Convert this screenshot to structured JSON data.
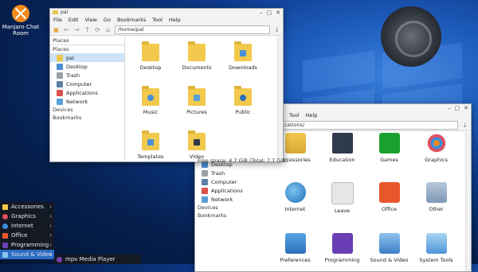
{
  "desktop": {
    "icon_label": "Manjaro Chat\nRoom"
  },
  "window1": {
    "title": "pal",
    "menu": [
      "File",
      "Edit",
      "View",
      "Go",
      "Bookmarks",
      "Tool",
      "Help"
    ],
    "path": "/home/pal",
    "places_header_top": "Places",
    "places_header": "Places",
    "places": [
      "pal",
      "Desktop",
      "Trash",
      "Computer",
      "Applications",
      "Network"
    ],
    "devices": "Devices",
    "bookmarks": "Bookmarks",
    "files": [
      "Desktop",
      "Documents",
      "Downloads",
      "Music",
      "Pictures",
      "Public",
      "Templates",
      "Video"
    ]
  },
  "window2": {
    "menu": [
      "Tool",
      "Help"
    ],
    "path": "lications/",
    "places": [
      "Desktop",
      "Trash",
      "Computer",
      "Applications",
      "Network"
    ],
    "devices": "Devices",
    "bookmarks": "Bookmarks",
    "status": "Free space: 4.7 GiB (Total: 7.7 GiB)",
    "apps": [
      "Accessories",
      "Education",
      "Games",
      "Graphics",
      "Internet",
      "Leave",
      "Office",
      "Other",
      "Preferences",
      "Programming",
      "Sound & Video",
      "System Tools"
    ]
  },
  "startmenu": {
    "items": [
      "Accessories",
      "Graphics",
      "Internet",
      "Office",
      "Programming",
      "Sound & Video"
    ],
    "submenu_item": "mpv Media Player"
  },
  "colors": {
    "folder": "#f2c94c",
    "selection": "#cfe3f7",
    "menu_active": "#2b6cc4"
  }
}
